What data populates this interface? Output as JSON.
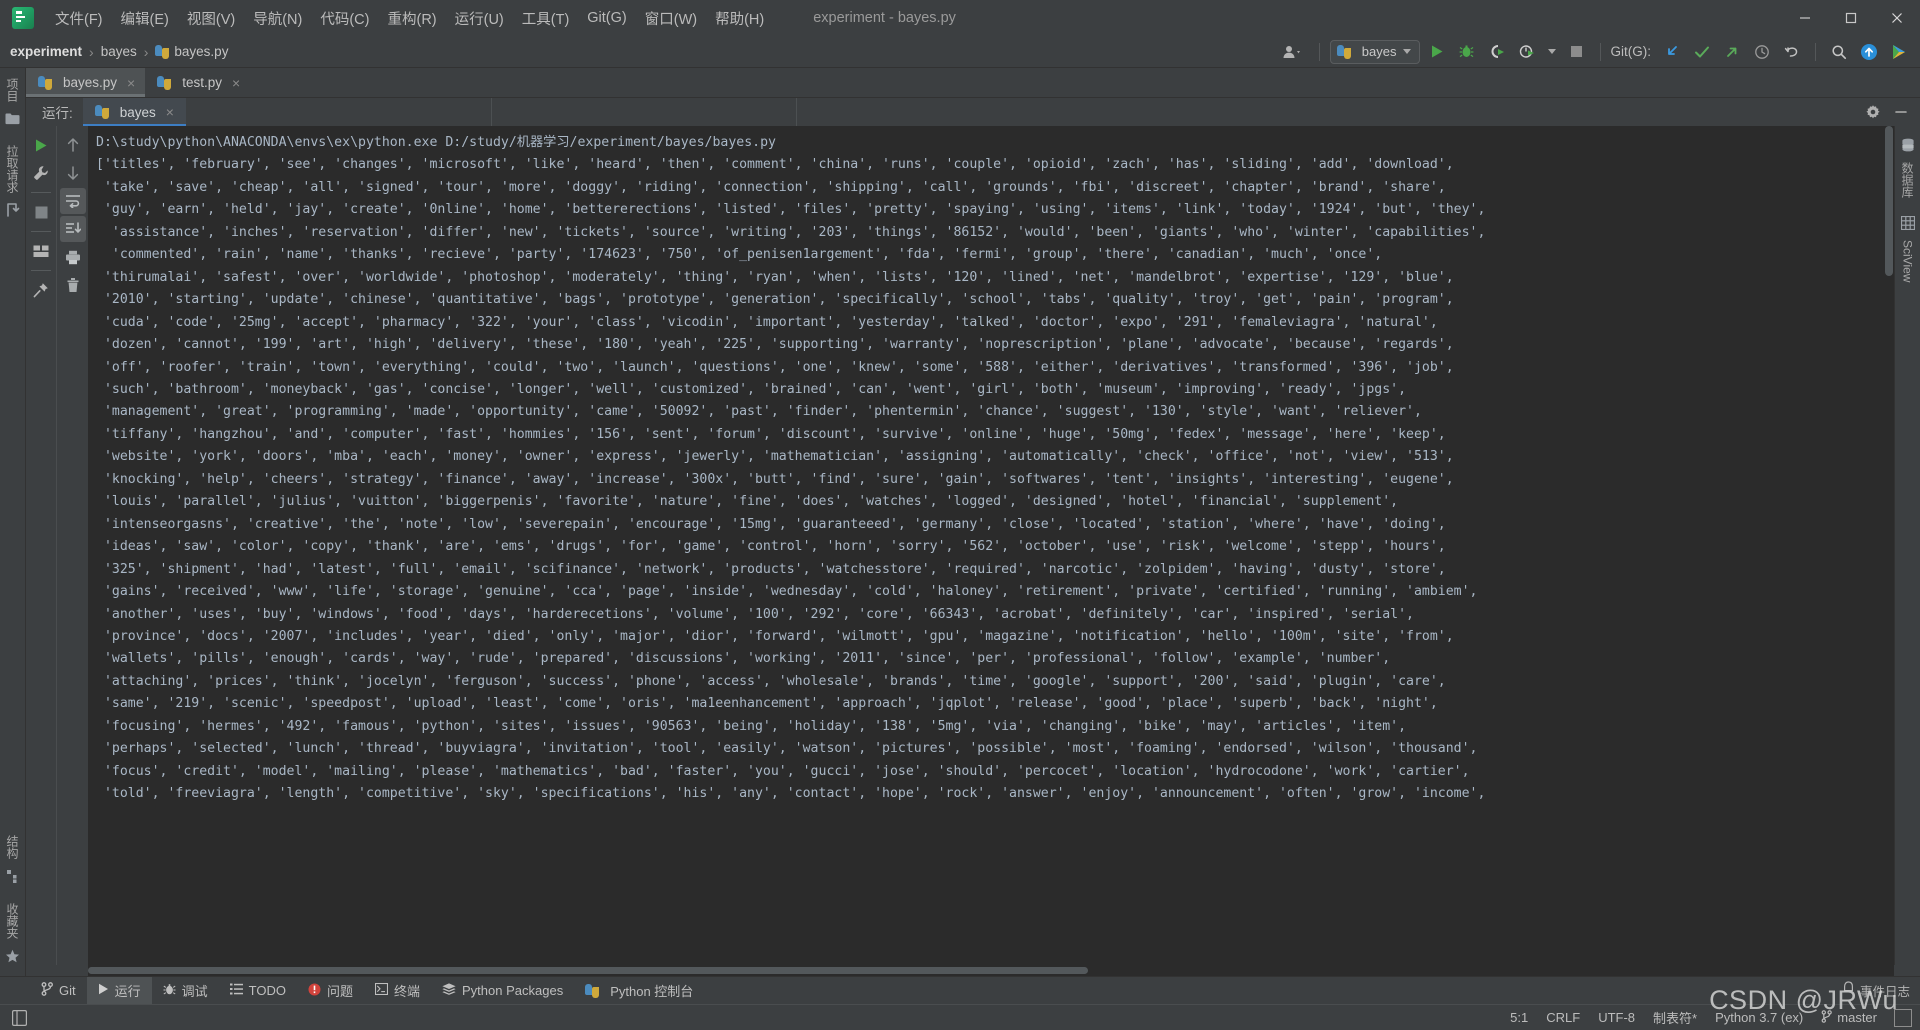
{
  "window": {
    "title": "experiment - bayes.py",
    "logo_icon": "pycharm-logo-icon",
    "minimize_icon": "minimize-icon",
    "maximize_icon": "maximize-icon",
    "close_icon": "close-icon"
  },
  "menu": [
    {
      "label": "文件(F)"
    },
    {
      "label": "编辑(E)"
    },
    {
      "label": "视图(V)"
    },
    {
      "label": "导航(N)"
    },
    {
      "label": "代码(C)"
    },
    {
      "label": "重构(R)"
    },
    {
      "label": "运行(U)"
    },
    {
      "label": "工具(T)"
    },
    {
      "label": "Git(G)"
    },
    {
      "label": "窗口(W)"
    },
    {
      "label": "帮助(H)"
    }
  ],
  "breadcrumb": {
    "items": [
      "experiment",
      "bayes",
      "bayes.py"
    ],
    "separator": "›"
  },
  "toolbar": {
    "account_icon": "account-icon",
    "run_config": "bayes",
    "run_icon": "run-icon",
    "debug_icon": "debug-icon",
    "coverage_icon": "run-with-coverage-icon",
    "profile_icon": "profile-icon",
    "stop_icon": "stop-icon",
    "git_label": "Git(G):",
    "update_icon": "git-update-icon",
    "commit_icon": "git-commit-icon",
    "push_icon": "git-push-icon",
    "history_icon": "history-icon",
    "undo_icon": "undo-icon",
    "search_icon": "search-everywhere-icon",
    "uploads_icon": "upload-icon",
    "ide_icon": "ide-features-icon"
  },
  "left_strip": {
    "project_label": "项目",
    "project_icon": "folder-icon",
    "pull_requests_label": "拉取请求",
    "pull_requests_icon": "pull-request-icon",
    "structure_label": "结构",
    "structure_icon": "structure-icon",
    "favorites_label": "收藏夹",
    "favorites_icon": "star-icon"
  },
  "right_strip": {
    "database_label": "数据库",
    "database_icon": "database-icon",
    "sciview_label": "SciView",
    "sciview_icon": "grid-icon"
  },
  "editor_tabs": [
    {
      "label": "bayes.py",
      "active": true,
      "icon": "python-file-icon",
      "close": "×"
    },
    {
      "label": "test.py",
      "active": false,
      "icon": "python-file-icon",
      "close": "×"
    }
  ],
  "run_panel": {
    "title": "运行:",
    "tab_label": "bayes",
    "tab_icon": "python-file-icon",
    "tab_close": "×",
    "settings_icon": "gear-icon",
    "hide_icon": "hide-icon",
    "left_tools": [
      {
        "name": "rerun-button",
        "icon": "run-icon"
      },
      {
        "name": "edit-configuration-button",
        "icon": "wrench-icon"
      },
      {
        "name": "stop-button",
        "icon": "stop-icon"
      },
      {
        "name": "layout-button",
        "icon": "layout-icon"
      },
      {
        "name": "pin-tab-button",
        "icon": "pin-icon"
      }
    ],
    "right_tools": [
      {
        "name": "scroll-up-button",
        "icon": "arrow-up-icon"
      },
      {
        "name": "scroll-down-button",
        "icon": "arrow-down-icon"
      },
      {
        "name": "soft-wrap-button",
        "icon": "soft-wrap-icon"
      },
      {
        "name": "scroll-to-end-button",
        "icon": "scroll-end-icon"
      },
      {
        "name": "print-button",
        "icon": "printer-icon"
      },
      {
        "name": "clear-all-button",
        "icon": "trash-icon"
      }
    ]
  },
  "console": {
    "command": "D:\\study\\python\\ANACONDA\\envs\\ex\\python.exe D:/study/机器学习/experiment/bayes/bayes.py",
    "output_lines": [
      "['titles', 'february', 'see', 'changes', 'microsoft', 'like', 'heard', 'then', 'comment', 'china', 'runs', 'couple', 'opioid', 'zach', 'has', 'sliding', 'add', 'download',",
      " 'take', 'save', 'cheap', 'all', 'signed', 'tour', 'more', 'doggy', 'riding', 'connection', 'shipping', 'call', 'grounds', 'fbi', 'discreet', 'chapter', 'brand', 'share',",
      " 'guy', 'earn', 'held', 'jay', 'create', '0nline', 'home', 'bettererections', 'listed', 'files', 'pretty', 'spaying', 'using', 'items', 'link', 'today', '1924', 'but', 'they',",
      "  'assistance', 'inches', 'reservation', 'differ', 'new', 'tickets', 'source', 'writing', '203', 'things', '86152', 'would', 'been', 'giants', 'who', 'winter', 'capabilities',",
      "  'commented', 'rain', 'name', 'thanks', 'recieve', 'party', '174623', '750', 'of_penisen1argement', 'fda', 'fermi', 'group', 'there', 'canadian', 'much', 'once',",
      " 'thirumalai', 'safest', 'over', 'worldwide', 'photoshop', 'moderately', 'thing', 'ryan', 'when', 'lists', '120', 'lined', 'net', 'mandelbrot', 'expertise', '129', 'blue',",
      " '2010', 'starting', 'update', 'chinese', 'quantitative', 'bags', 'prototype', 'generation', 'specifically', 'school', 'tabs', 'quality', 'troy', 'get', 'pain', 'program',",
      " 'cuda', 'code', '25mg', 'accept', 'pharmacy', '322', 'your', 'class', 'vicodin', 'important', 'yesterday', 'talked', 'doctor', 'expo', '291', 'femaleviagra', 'natural',",
      " 'dozen', 'cannot', '199', 'art', 'high', 'delivery', 'these', '180', 'yeah', '225', 'supporting', 'warranty', 'noprescription', 'plane', 'advocate', 'because', 'regards',",
      " 'off', 'roofer', 'train', 'town', 'everything', 'could', 'two', 'launch', 'questions', 'one', 'knew', 'some', '588', 'either', 'derivatives', 'transformed', '396', 'job',",
      " 'such', 'bathroom', 'moneyback', 'gas', 'concise', 'longer', 'well', 'customized', 'brained', 'can', 'went', 'girl', 'both', 'museum', 'improving', 'ready', 'jpgs',",
      " 'management', 'great', 'programming', 'made', 'opportunity', 'came', '50092', 'past', 'finder', 'phentermin', 'chance', 'suggest', '130', 'style', 'want', 'reliever',",
      " 'tiffany', 'hangzhou', 'and', 'computer', 'fast', 'hommies', '156', 'sent', 'forum', 'discount', 'survive', 'online', 'huge', '50mg', 'fedex', 'message', 'here', 'keep',",
      " 'website', 'york', 'doors', 'mba', 'each', 'money', 'owner', 'express', 'jewerly', 'mathematician', 'assigning', 'automatically', 'check', 'office', 'not', 'view', '513',",
      " 'knocking', 'help', 'cheers', 'strategy', 'finance', 'away', 'increase', '300x', 'butt', 'find', 'sure', 'gain', 'softwares', 'tent', 'insights', 'interesting', 'eugene',",
      " 'louis', 'parallel', 'julius', 'vuitton', 'biggerpenis', 'favorite', 'nature', 'fine', 'does', 'watches', 'logged', 'designed', 'hotel', 'financial', 'supplement',",
      " 'intenseorgasns', 'creative', 'the', 'note', 'low', 'severepain', 'encourage', '15mg', 'guaranteeed', 'germany', 'close', 'located', 'station', 'where', 'have', 'doing',",
      " 'ideas', 'saw', 'color', 'copy', 'thank', 'are', 'ems', 'drugs', 'for', 'game', 'control', 'horn', 'sorry', '562', 'october', 'use', 'risk', 'welcome', 'stepp', 'hours',",
      " '325', 'shipment', 'had', 'latest', 'full', 'email', 'scifinance', 'network', 'products', 'watchesstore', 'required', 'narcotic', 'zolpidem', 'having', 'dusty', 'store',",
      " 'gains', 'received', 'www', 'life', 'storage', 'genuine', 'cca', 'page', 'inside', 'wednesday', 'cold', 'haloney', 'retirement', 'private', 'certified', 'running', 'ambiem',",
      " 'another', 'uses', 'buy', 'windows', 'food', 'days', 'harderecetions', 'volume', '100', '292', 'core', '66343', 'acrobat', 'definitely', 'car', 'inspired', 'serial',",
      " 'province', 'docs', '2007', 'includes', 'year', 'died', 'only', 'major', 'dior', 'forward', 'wilmott', 'gpu', 'magazine', 'notification', 'hello', '100m', 'site', 'from',",
      " 'wallets', 'pills', 'enough', 'cards', 'way', 'rude', 'prepared', 'discussions', 'working', '2011', 'since', 'per', 'professional', 'follow', 'example', 'number',",
      " 'attaching', 'prices', 'think', 'jocelyn', 'ferguson', 'success', 'phone', 'access', 'wholesale', 'brands', 'time', 'google', 'support', '200', 'said', 'plugin', 'care',",
      " 'same', '219', 'scenic', 'speedpost', 'upload', 'least', 'come', 'oris', 'ma1eenhancement', 'approach', 'jqplot', 'release', 'good', 'place', 'superb', 'back', 'night',",
      " 'focusing', 'hermes', '492', 'famous', 'python', 'sites', 'issues', '90563', 'being', 'holiday', '138', '5mg', 'via', 'changing', 'bike', 'may', 'articles', 'item',",
      " 'perhaps', 'selected', 'lunch', 'thread', 'buyviagra', 'invitation', 'tool', 'easily', 'watson', 'pictures', 'possible', 'most', 'foaming', 'endorsed', 'wilson', 'thousand',",
      " 'focus', 'credit', 'model', 'mailing', 'please', 'mathematics', 'bad', 'faster', 'you', 'gucci', 'jose', 'should', 'percocet', 'location', 'hydrocodone', 'work', 'cartier',",
      " 'told', 'freeviagra', 'length', 'competitive', 'sky', 'specifications', 'his', 'any', 'contact', 'hope', 'rock', 'answer', 'enjoy', 'announcement', 'often', 'grow', 'income',"
    ]
  },
  "bottom_toolbar": {
    "items": [
      {
        "label": "Git",
        "icon": "git-branch-icon",
        "active": false
      },
      {
        "label": "运行",
        "icon": "run-icon",
        "active": true
      },
      {
        "label": "调试",
        "icon": "debug-icon",
        "active": false
      },
      {
        "label": "TODO",
        "icon": "todo-list-icon",
        "active": false
      },
      {
        "label": "问题",
        "icon": "problems-icon",
        "active": false
      },
      {
        "label": "终端",
        "icon": "terminal-icon",
        "active": false
      },
      {
        "label": "Python Packages",
        "icon": "packages-icon",
        "active": false
      },
      {
        "label": "Python 控制台",
        "icon": "python-console-icon",
        "active": false
      }
    ],
    "event_log_label": "事件日志",
    "event_log_icon": "bell-icon"
  },
  "statusbar": {
    "layout_icon": "layout-toggle-icon",
    "caret_position": "5:1",
    "line_separator": "CRLF",
    "encoding": "UTF-8",
    "indent": "制表符*",
    "interpreter": "Python 3.7 (ex)",
    "branch": "master",
    "branch_icon": "git-branch-icon"
  },
  "watermark": "CSDN @JRWu",
  "colors": {
    "chrome_bg": "#3c3f41",
    "console_bg": "#2b2b2b",
    "console_fg": "#a9b7c6",
    "accent_blue": "#3d7ec4",
    "run_green": "#4a9e52",
    "error_red": "#c75450"
  }
}
